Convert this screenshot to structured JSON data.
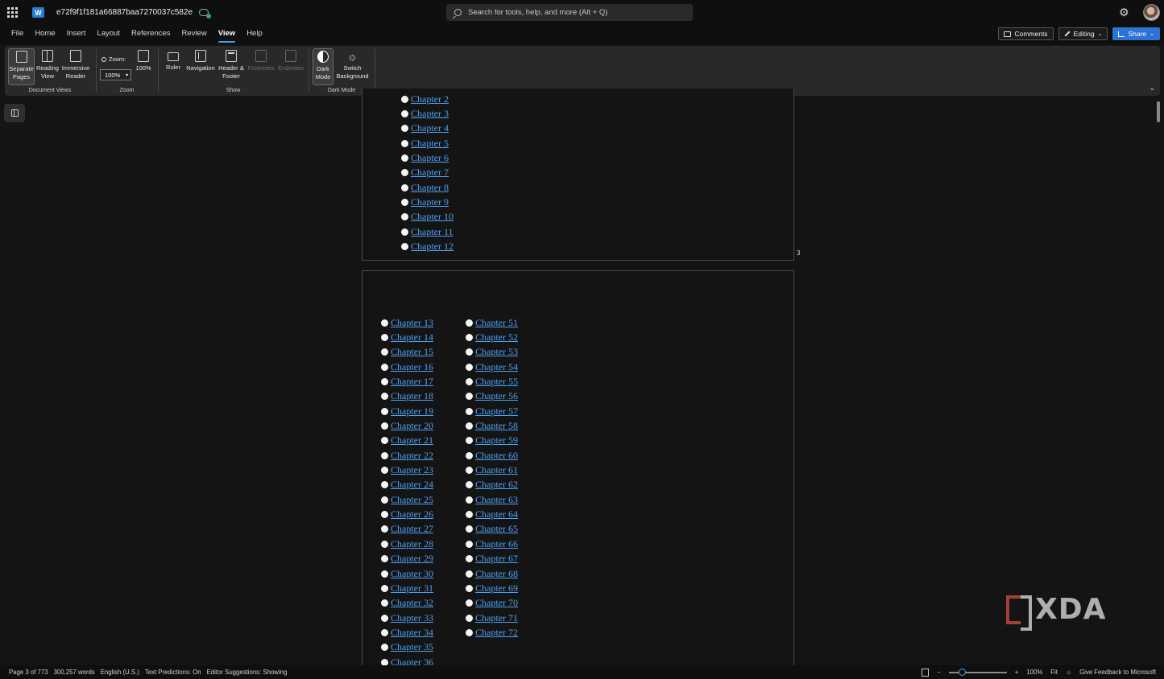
{
  "titlebar": {
    "document_name": "e72f9f1f181a66887baa7270037c582e",
    "search_placeholder": "Search for tools, help, and more (Alt + Q)",
    "app_badge": "W"
  },
  "menu": {
    "tabs": [
      "File",
      "Home",
      "Insert",
      "Layout",
      "References",
      "Review",
      "View",
      "Help"
    ],
    "active_tab": "View",
    "comments_label": "Comments",
    "editing_label": "Editing",
    "share_label": "Share"
  },
  "ribbon": {
    "document_views": {
      "label": "Document Views",
      "separate_pages": [
        "Separate",
        "Pages"
      ],
      "reading_view": [
        "Reading",
        "View"
      ],
      "immersive_reader": [
        "Immersive",
        "Reader"
      ]
    },
    "zoom": {
      "label": "Zoom",
      "zoom_caption": "Zoom:",
      "zoom_value": "100%",
      "hundred_percent": "100%"
    },
    "show": {
      "label": "Show",
      "ruler": "Ruler",
      "navigation": "Navigation",
      "header_footer": [
        "Header &",
        "Footer"
      ],
      "footnotes": "Footnotes",
      "endnotes": "Endnotes"
    },
    "dark_mode": {
      "label": "Dark Mode",
      "dark_mode_button": [
        "Dark",
        "Mode"
      ],
      "switch_background": [
        "Switch",
        "Background"
      ]
    }
  },
  "document": {
    "page1_chapters": [
      "Chapter 2",
      "Chapter 3",
      "Chapter 4",
      "Chapter 5",
      "Chapter 6",
      "Chapter 7",
      "Chapter 8",
      "Chapter 9",
      "Chapter 10",
      "Chapter 11",
      "Chapter 12"
    ],
    "page_number": "3",
    "page2_col1": [
      "Chapter 13",
      "Chapter 14",
      "Chapter 15",
      "Chapter 16",
      "Chapter 17",
      "Chapter 18",
      "Chapter 19",
      "Chapter 20",
      "Chapter 21",
      "Chapter 22",
      "Chapter 23",
      "Chapter 24",
      "Chapter 25",
      "Chapter 26",
      "Chapter 27",
      "Chapter 28",
      "Chapter 29",
      "Chapter 30",
      "Chapter 31",
      "Chapter 32",
      "Chapter 33",
      "Chapter 34",
      "Chapter 35",
      "Chapter 36"
    ],
    "page2_col2": [
      "Chapter 51",
      "Chapter 52",
      "Chapter 53",
      "Chapter 54",
      "Chapter 55",
      "Chapter 56",
      "Chapter 57",
      "Chapter 58",
      "Chapter 59",
      "Chapter 60",
      "Chapter 61",
      "Chapter 62",
      "Chapter 63",
      "Chapter 64",
      "Chapter 65",
      "Chapter 66",
      "Chapter 67",
      "Chapter 68",
      "Chapter 69",
      "Chapter 70",
      "Chapter 71",
      "Chapter 72"
    ]
  },
  "watermark": "XDA",
  "statusbar": {
    "page": "Page 3 of 773",
    "words": "300,257 words",
    "language": "English (U.S.)",
    "text_predictions": "Text Predictions: On",
    "editor_suggestions": "Editor Suggestions: Showing",
    "zoom_percent": "100%",
    "fit": "Fit",
    "feedback": "Give Feedback to Microsoft"
  },
  "colors": {
    "accent": "#4c9bf2",
    "link": "#4ea1f3",
    "share_button": "#2b73d6"
  },
  "icons": [
    "app-launcher-icon",
    "word-logo-icon",
    "saved-cloud-icon",
    "search-icon",
    "gear-icon",
    "comment-icon",
    "pencil-icon",
    "share-icon",
    "nav-pane-icon"
  ]
}
